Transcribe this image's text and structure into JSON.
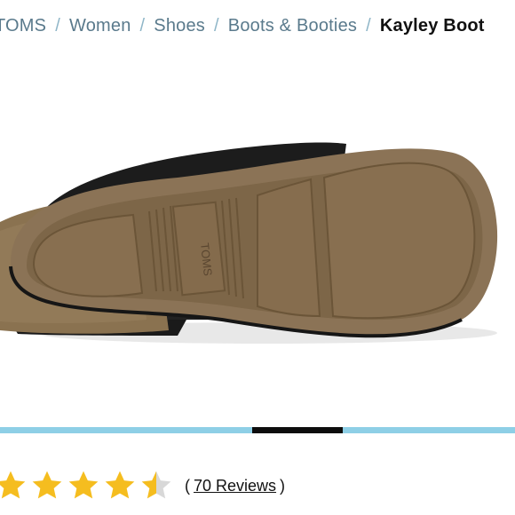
{
  "breadcrumb": {
    "items": [
      "TOMS",
      "Women",
      "Shoes",
      "Boots & Booties"
    ],
    "current": "Kayley Boot",
    "separator": "/"
  },
  "product_image": {
    "alt": "Kayley Boot sole view",
    "sole_logo": "TOMS"
  },
  "carousel": {
    "active_index": 3,
    "count": 6
  },
  "rating": {
    "value": 4.5,
    "max": 5,
    "open_paren": "(",
    "reviews_label": "70 Reviews",
    "close_paren": ")"
  },
  "colors": {
    "star": "#f5bd1f",
    "star_empty": "#d8d8d8",
    "indicator_track": "#8ecfe6",
    "indicator_active": "#0d0d0d",
    "crumb_link": "#5a7a8c"
  }
}
